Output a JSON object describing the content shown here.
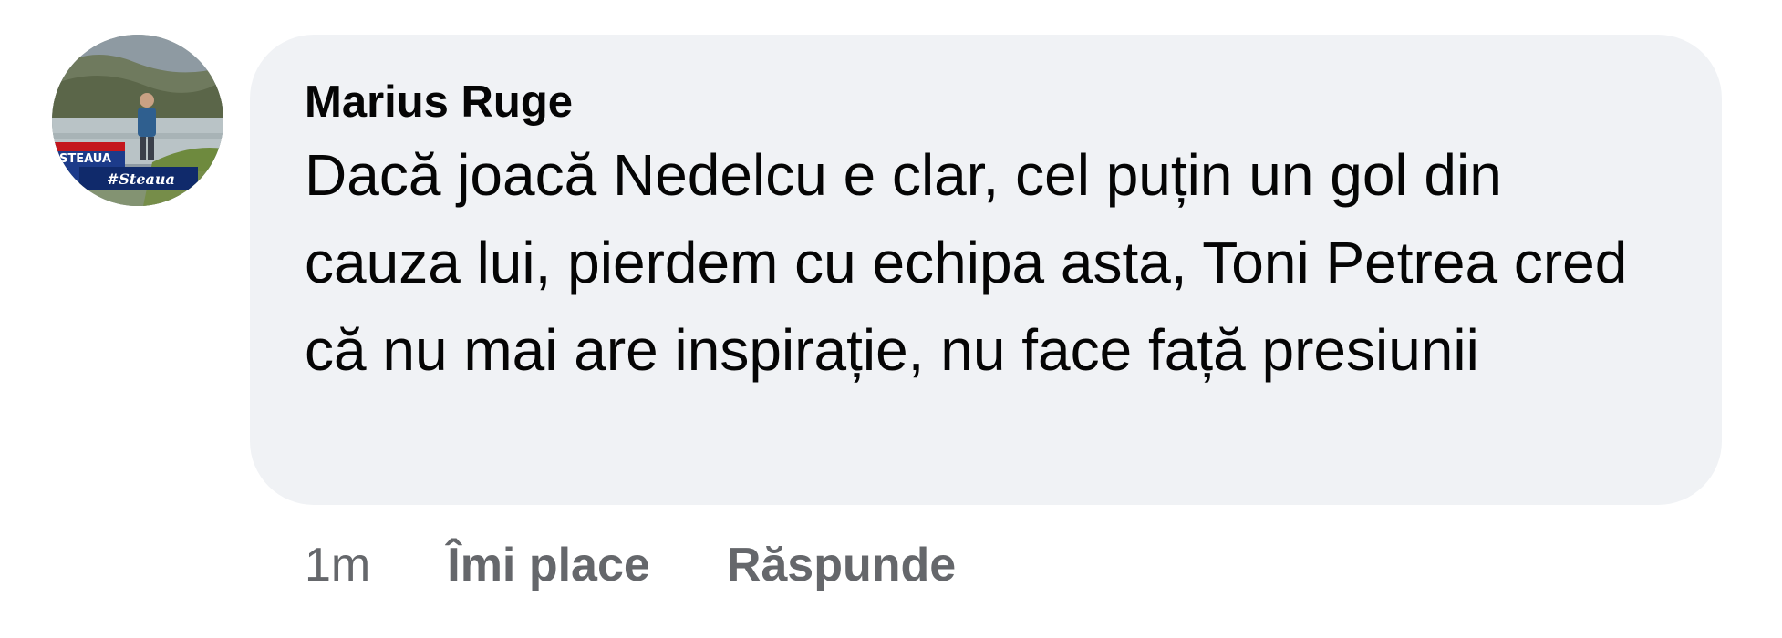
{
  "comment": {
    "author": "Marius Ruge",
    "text": "Dacă joacă Nedelcu e clar, cel puțin un gol din cauza lui, pierdem cu echipa asta, Toni Petrea cred că nu mai are inspirație, nu face față presiunii",
    "avatar_logo_text": "STEAUA",
    "avatar_logo_subtext": "#Steaua"
  },
  "actions": {
    "timestamp": "1m",
    "like_label": "Îmi place",
    "reply_label": "Răspunde"
  },
  "colors": {
    "bubble_background": "#f0f2f5",
    "text_primary": "#050505",
    "text_secondary": "#65676b"
  }
}
